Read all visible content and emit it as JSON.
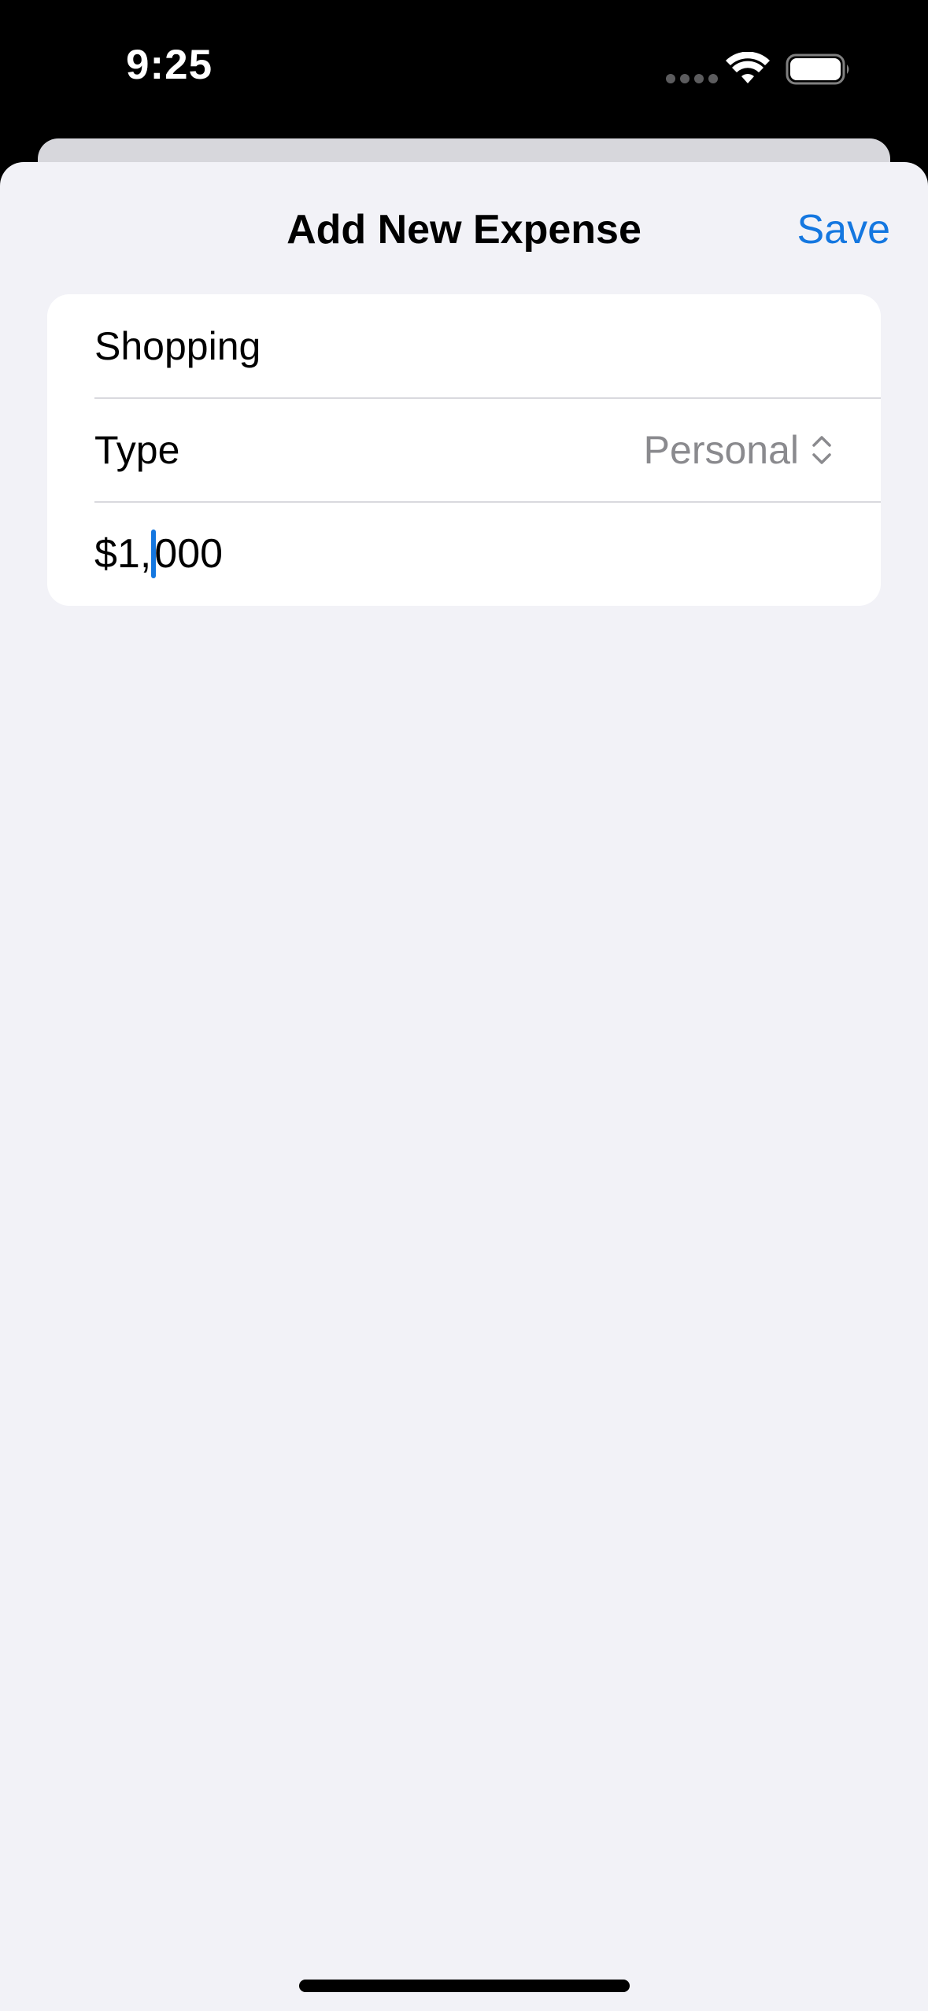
{
  "status": {
    "time": "9:25"
  },
  "sheet": {
    "title": "Add New Expense",
    "save_label": "Save"
  },
  "form": {
    "name_value": "Shopping",
    "type_label": "Type",
    "type_value": "Personal",
    "amount_before_cursor": "$1,",
    "amount_after_cursor": "000"
  },
  "colors": {
    "accent": "#1477e0",
    "background": "#f2f2f7",
    "secondary_text": "#8a8a8e"
  },
  "icons": [
    "wifi-icon",
    "battery-icon",
    "chevron-updown-icon"
  ]
}
